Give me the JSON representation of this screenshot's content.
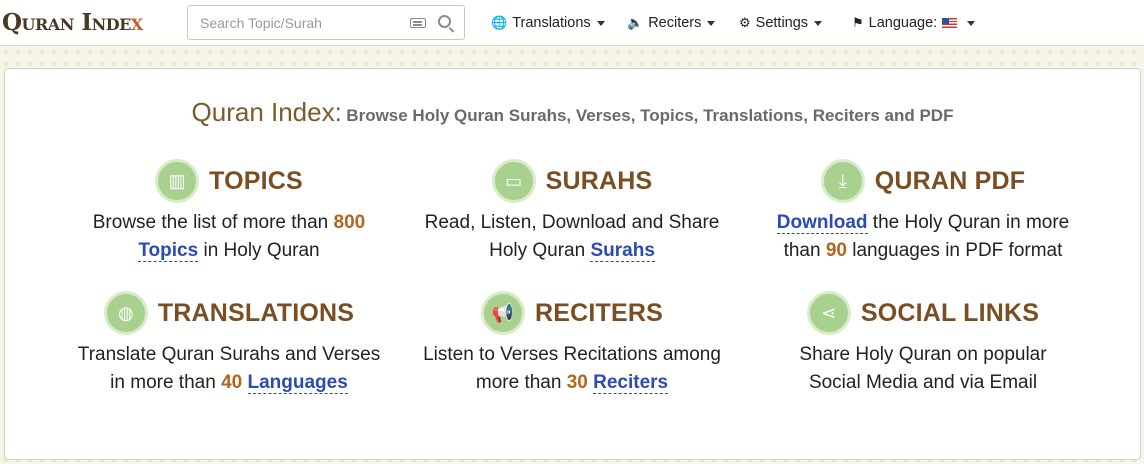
{
  "header": {
    "logo_main": "Quran Inde",
    "logo_x": "x",
    "search_placeholder": "Search Topic/Surah",
    "nav": {
      "translations": "Translations",
      "reciters": "Reciters",
      "settings": "Settings",
      "language": "Language:"
    }
  },
  "hero": {
    "brand": "Quran Index",
    "colon": ":",
    "tagline": "Browse Holy Quran Surahs, Verses, Topics, Translations, Reciters and PDF"
  },
  "features": {
    "topics": {
      "title": "TOPICS",
      "pre": "Browse the list of more than ",
      "num": "800",
      "link": "Topics",
      "post": " in Holy Quran"
    },
    "surahs": {
      "title": "SURAHS",
      "line1": "Read, Listen, Download and Share",
      "pre2": "Holy Quran ",
      "link": "Surahs"
    },
    "pdf": {
      "title": "QURAN PDF",
      "link": "Download",
      "post1": " the Holy Quran in more",
      "pre2": "than ",
      "num": "90",
      "post2": " languages in PDF format"
    },
    "translations": {
      "title": "TRANSLATIONS",
      "line1": "Translate Quran Surahs and Verses",
      "pre2": "in more than ",
      "num": "40",
      "link": "Languages"
    },
    "reciters": {
      "title": "RECITERS",
      "line1": "Listen to Verses Recitations among",
      "pre2": "more than ",
      "num": "30",
      "link": "Reciters"
    },
    "social": {
      "title": "SOCIAL LINKS",
      "line1": "Share Holy Quran on popular",
      "line2": "Social Media and via Email"
    }
  },
  "colors": {
    "brand": "#7a5a2e",
    "accent": "#b3651e",
    "link": "#2a4bb4",
    "icon_bg": "#a8d08f"
  }
}
